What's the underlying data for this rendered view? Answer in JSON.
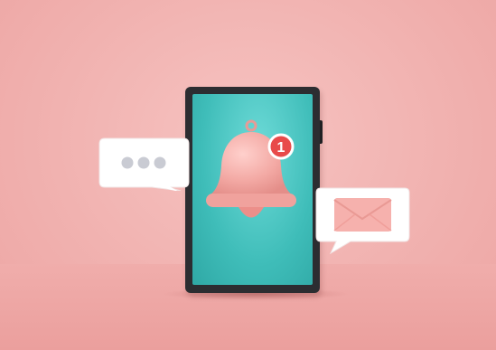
{
  "notification": {
    "badge_count": "1"
  },
  "icons": {
    "bell": "notification-bell-icon",
    "chat": "chat-bubble-icon",
    "mail": "envelope-icon"
  },
  "colors": {
    "background": "#f1b2b0",
    "screen": "#3fbdb9",
    "bell": "#f3a9a4",
    "badge": "#e84a4a",
    "bubble": "#ffffff",
    "envelope": "#f6b1ad",
    "dots": "#c9cbd3"
  }
}
